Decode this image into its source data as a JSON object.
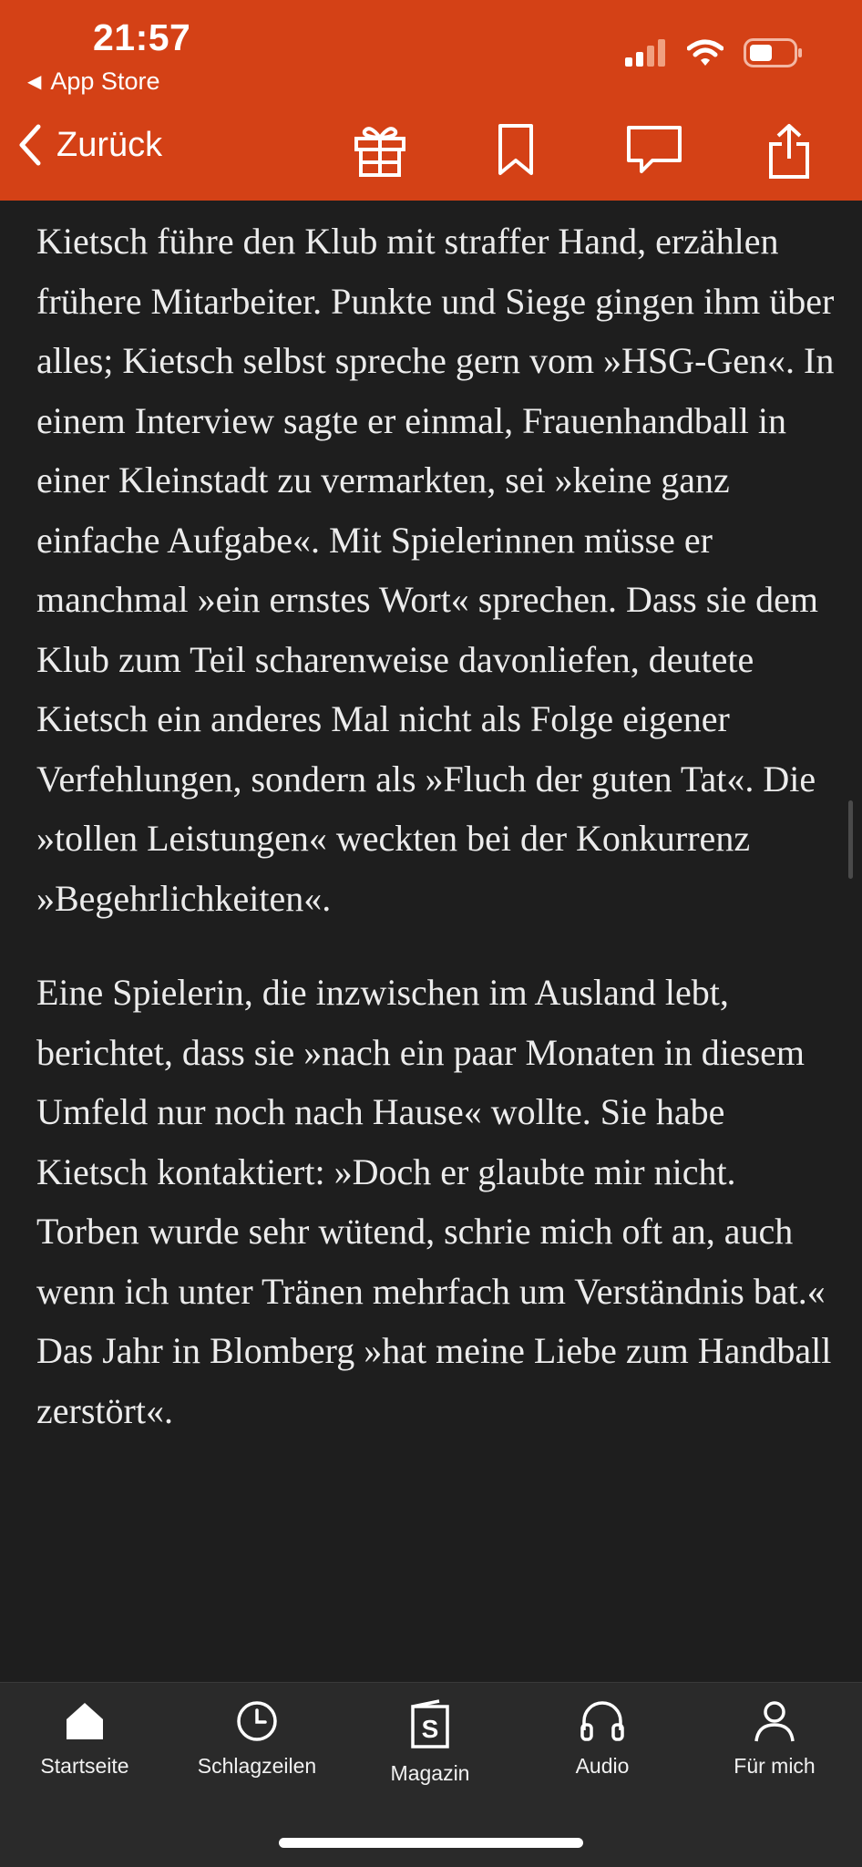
{
  "status_bar": {
    "time": "21:57",
    "back_app_label": "App Store"
  },
  "navbar": {
    "back_label": "Zurück"
  },
  "article": {
    "paragraphs": [
      "Kietsch führe den Klub mit straffer Hand, erzählen frühere Mitarbeiter. Punkte und Siege gingen ihm über alles; Kietsch selbst spreche gern vom »HSG-Gen«. In einem Interview sagte er einmal, Frauenhandball in einer Kleinstadt zu vermarkten, sei »keine ganz einfache Aufgabe«. Mit Spielerinnen müsse er manchmal »ein ernstes Wort« sprechen. Dass sie dem Klub zum Teil scharenweise davonliefen, deutete Kietsch ein anderes Mal nicht als Folge eigener Verfehlungen, sondern als »Fluch der guten Tat«. Die »tollen Leistungen« weckten bei der Konkurrenz »Begehrlichkeiten«.",
      "Eine Spielerin, die inzwischen im Ausland lebt, berichtet, dass sie »nach ein paar Monaten in diesem Umfeld nur noch nach Hause« wollte. Sie habe Kietsch kontaktiert: »Doch er glaubte mir nicht. Torben wurde sehr wütend, schrie mich oft an, auch wenn ich unter Tränen mehrfach um Verständnis bat.« Das Jahr in Blomberg »hat meine Liebe zum Handball zerstört«."
    ]
  },
  "tabbar": {
    "tabs": [
      {
        "label": "Startseite",
        "icon": "home-icon"
      },
      {
        "label": "Schlagzeilen",
        "icon": "clock-icon"
      },
      {
        "label": "Magazin",
        "icon": "magazine-icon"
      },
      {
        "label": "Audio",
        "icon": "headphones-icon"
      },
      {
        "label": "Für mich",
        "icon": "person-icon"
      }
    ]
  },
  "colors": {
    "header": "#d44116",
    "background": "#1e1e1e",
    "tabbar": "#2a2a2a",
    "text": "#ececec"
  }
}
